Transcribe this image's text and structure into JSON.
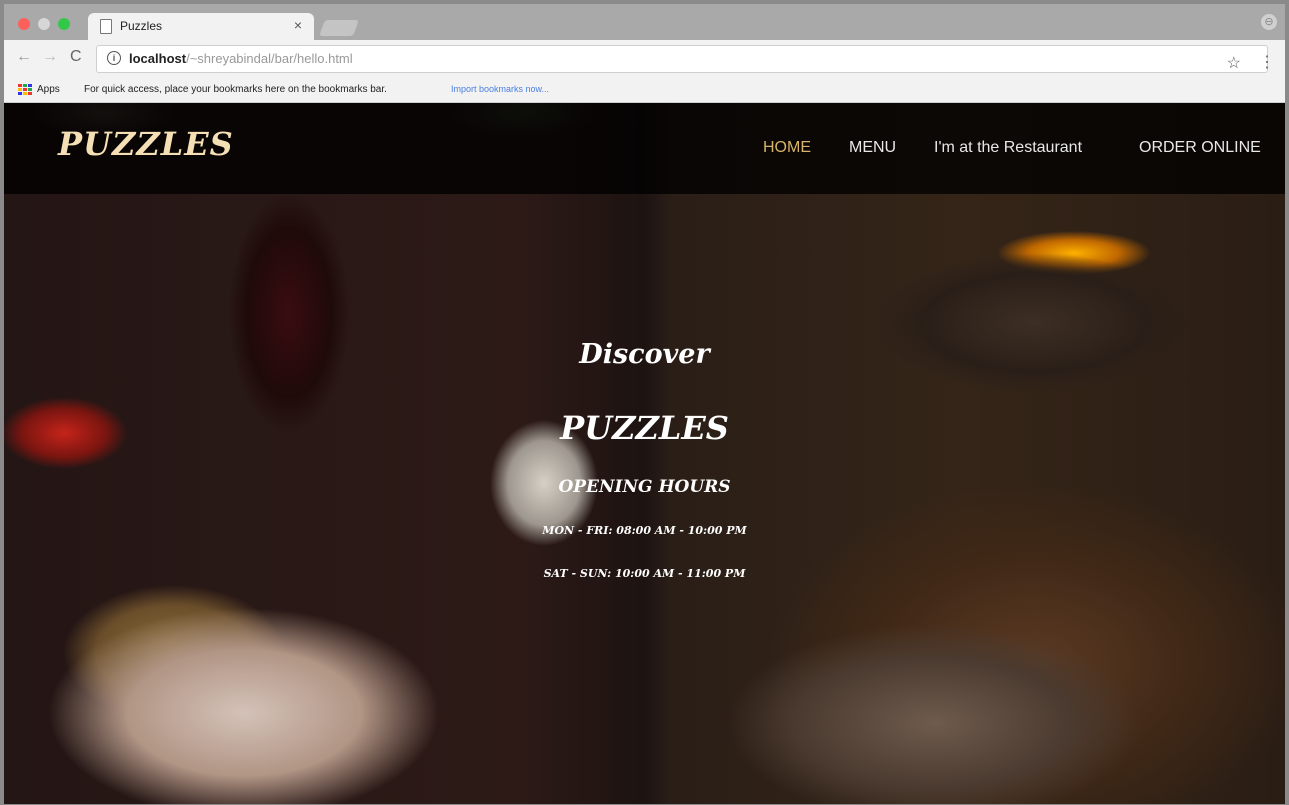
{
  "browser": {
    "tab_title": "Puzzles",
    "tab_close": "×",
    "url_host": "localhost",
    "url_path": "/~shreyabindal/bar/hello.html",
    "nav_back": "←",
    "nav_forward": "→",
    "nav_reload": "C",
    "info_glyph": "i",
    "star_glyph": "☆",
    "menu_glyph": "⋮",
    "profile_glyph": "⊖"
  },
  "bookmarks": {
    "apps_label": "Apps",
    "hint": "For quick access, place your bookmarks here on the bookmarks bar.",
    "import_link": "Import bookmarks now..."
  },
  "site": {
    "logo": "PUZZLES",
    "nav": {
      "home": "HOME",
      "menu": "MENU",
      "restaurant": "I'm at the Restaurant",
      "order": "ORDER ONLINE"
    },
    "hero": {
      "discover": "Discover",
      "name": "PUZZLES",
      "hours_title": "OPENING HOURS",
      "hours_weekday": "MON - FRI: 08:00 AM - 10:00 PM",
      "hours_weekend": "SAT - SUN: 10:00 AM - 11:00 PM"
    }
  },
  "colors": {
    "nav_active": "#d8b46a",
    "logo": "#f5dfb4",
    "import_link": "#4a7fe0"
  }
}
